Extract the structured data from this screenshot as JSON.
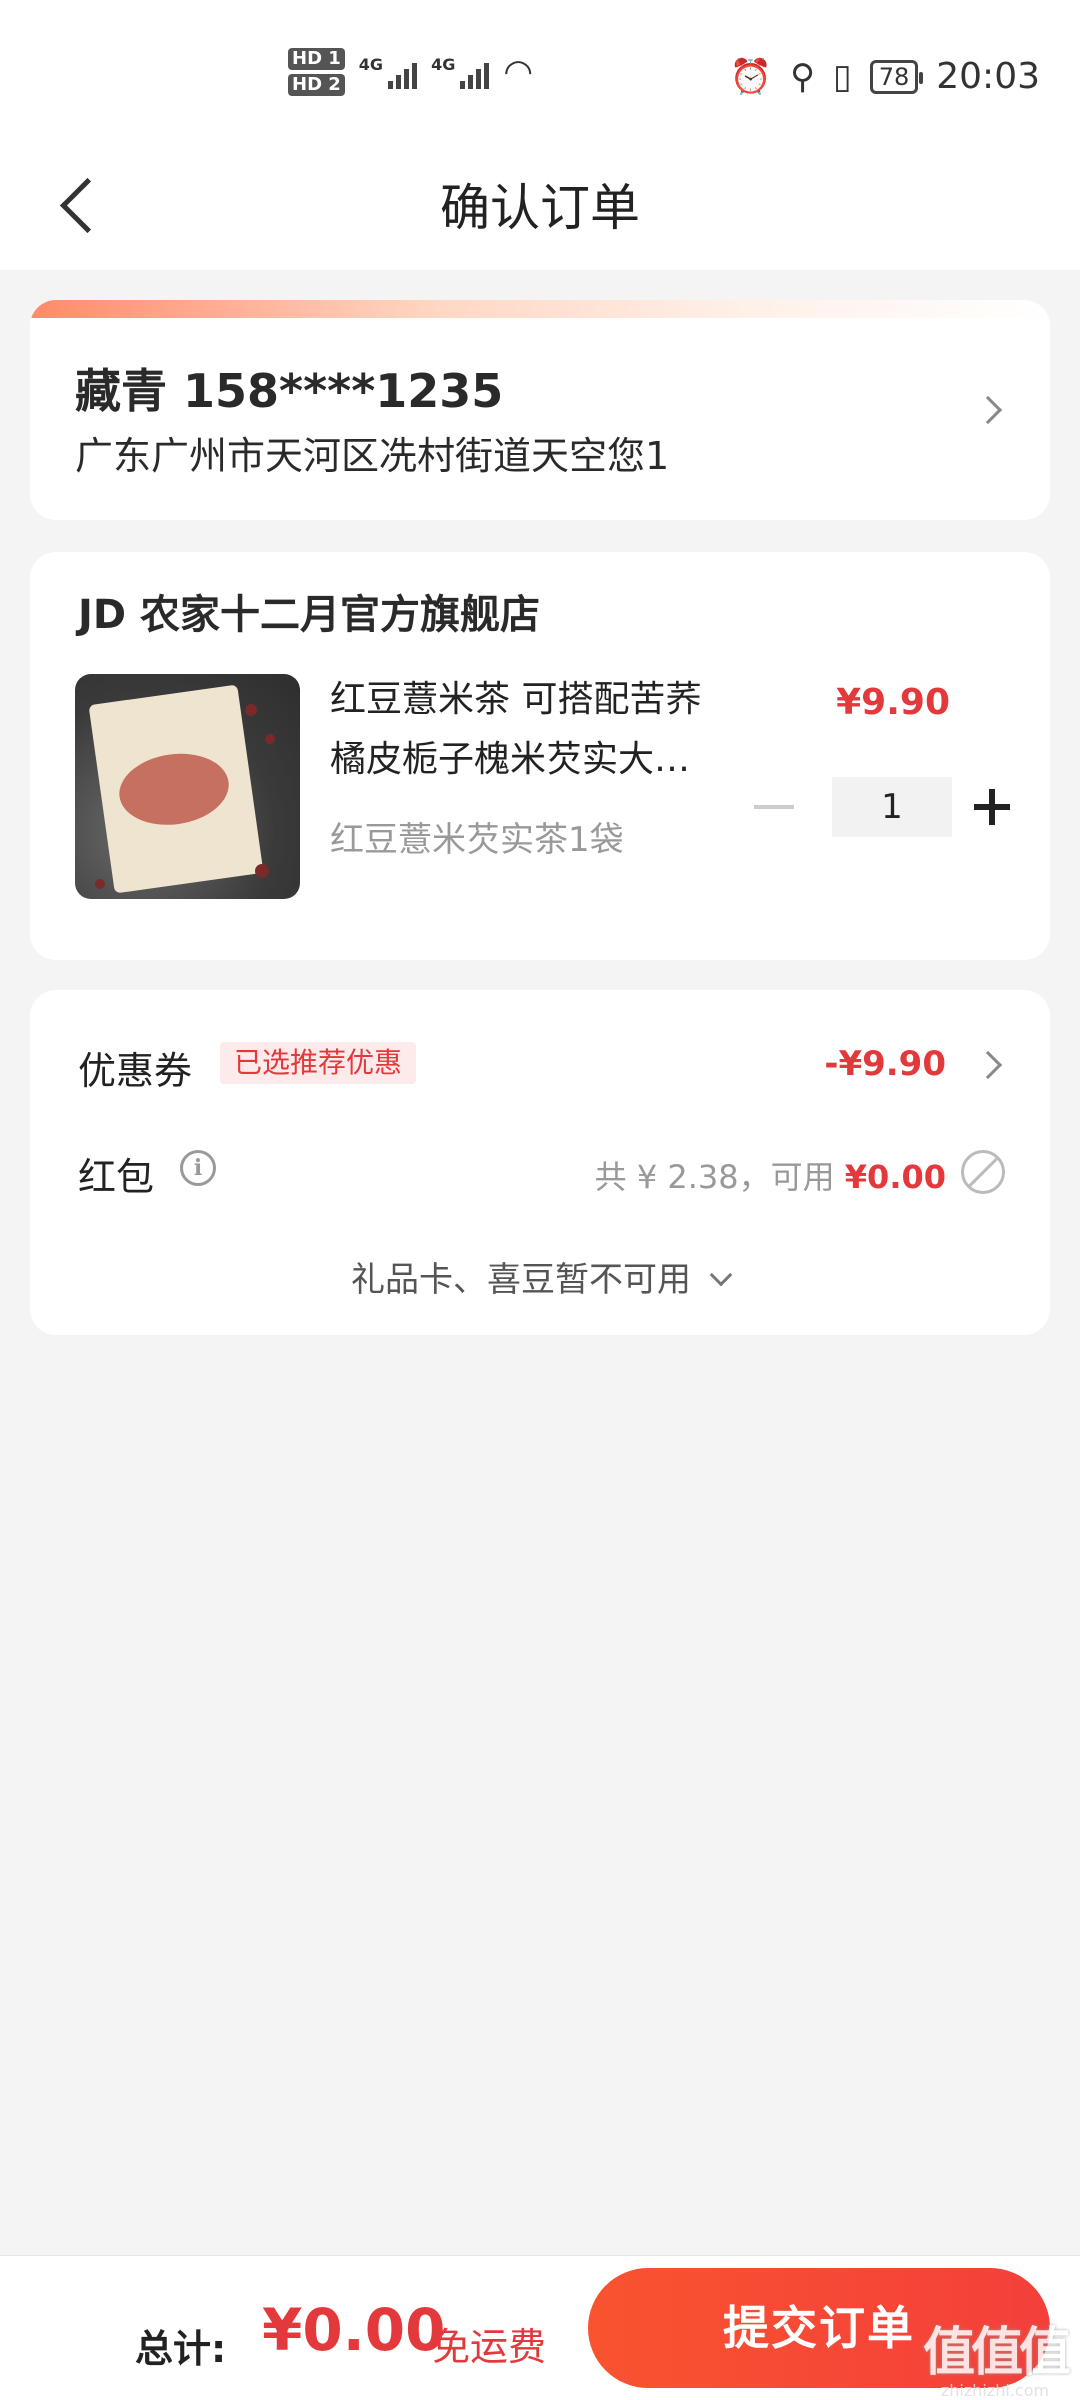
{
  "status_bar": {
    "hd1": "HD 1",
    "hd2": "HD 2",
    "net1": "4G",
    "net2": "4G",
    "battery": "78",
    "time": "20:03"
  },
  "nav": {
    "title": "确认订单"
  },
  "address": {
    "name_phone": "藏青 158****1235",
    "detail": "广东广州市天河区冼村街道天空您1"
  },
  "shop": {
    "name": "JD 农家十二月官方旗舰店",
    "product": {
      "title_line1": "红豆薏米茶 可搭配苦荞",
      "title_line2": "橘皮栀子槐米芡实大…",
      "spec": "红豆薏米芡实茶1袋",
      "price": "¥9.90",
      "quantity": "1"
    }
  },
  "discounts": {
    "coupon_label": "优惠券",
    "coupon_tag": "已选推荐优惠",
    "coupon_value": "-¥9.90",
    "hongbao_label": "红包",
    "hongbao_total": "共 ¥ 2.38，可用 ",
    "hongbao_available": "¥0.00",
    "gift_note": "礼品卡、喜豆暂不可用"
  },
  "footer": {
    "total_label": "总计:",
    "total_value": "¥0.00",
    "shipping": "免运费",
    "submit_label": "提交订单"
  },
  "watermark": {
    "main": "值值值",
    "sub": "zhizhizhi.com"
  },
  "colors": {
    "accent": "#e4393c",
    "submit_start": "#f9532f",
    "submit_end": "#f43f3b",
    "background": "#f4f4f4"
  }
}
